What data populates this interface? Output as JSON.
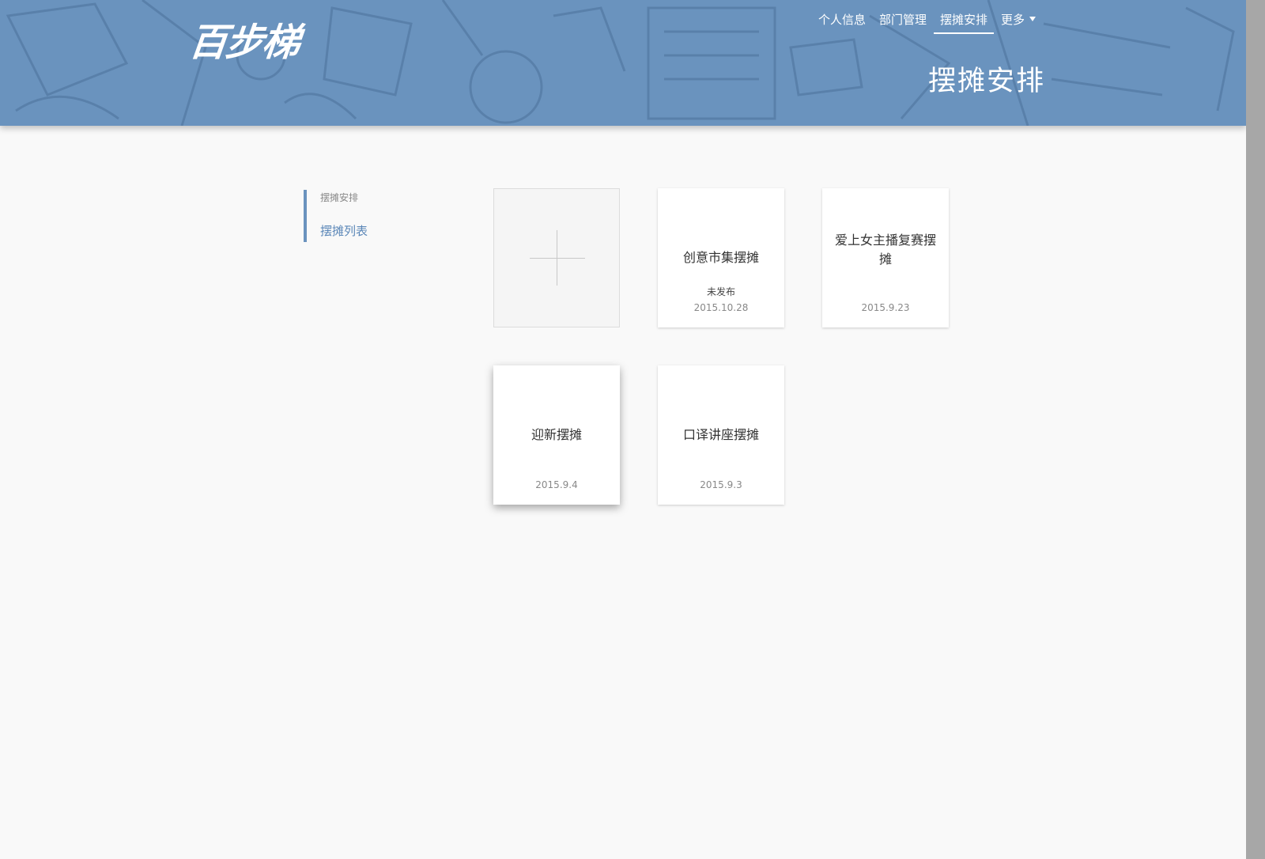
{
  "header": {
    "logo_text": "百步梯",
    "title": "摆摊安排",
    "nav": [
      {
        "label": "个人信息",
        "active": false
      },
      {
        "label": "部门管理",
        "active": false
      },
      {
        "label": "摆摊安排",
        "active": true
      },
      {
        "label": "更多",
        "active": false,
        "dropdown": true
      }
    ],
    "background_color": "#6a93be"
  },
  "sidebar": {
    "heading": "摆摊安排",
    "items": [
      {
        "label": "摆摊列表"
      }
    ],
    "accent_color": "#6a93be"
  },
  "cards": [
    {
      "title": "创意市集摆摊",
      "status": "未发布",
      "date": "2015.10.28"
    },
    {
      "title": "爱上女主播复赛摆摊",
      "status": "",
      "date": "2015.9.23"
    },
    {
      "title": "迎新摆摊",
      "status": "",
      "date": "2015.9.4"
    },
    {
      "title": "口译讲座摆摊",
      "status": "",
      "date": "2015.9.3"
    }
  ],
  "icons": {
    "add": "plus-icon",
    "more": "caret-down-icon"
  }
}
